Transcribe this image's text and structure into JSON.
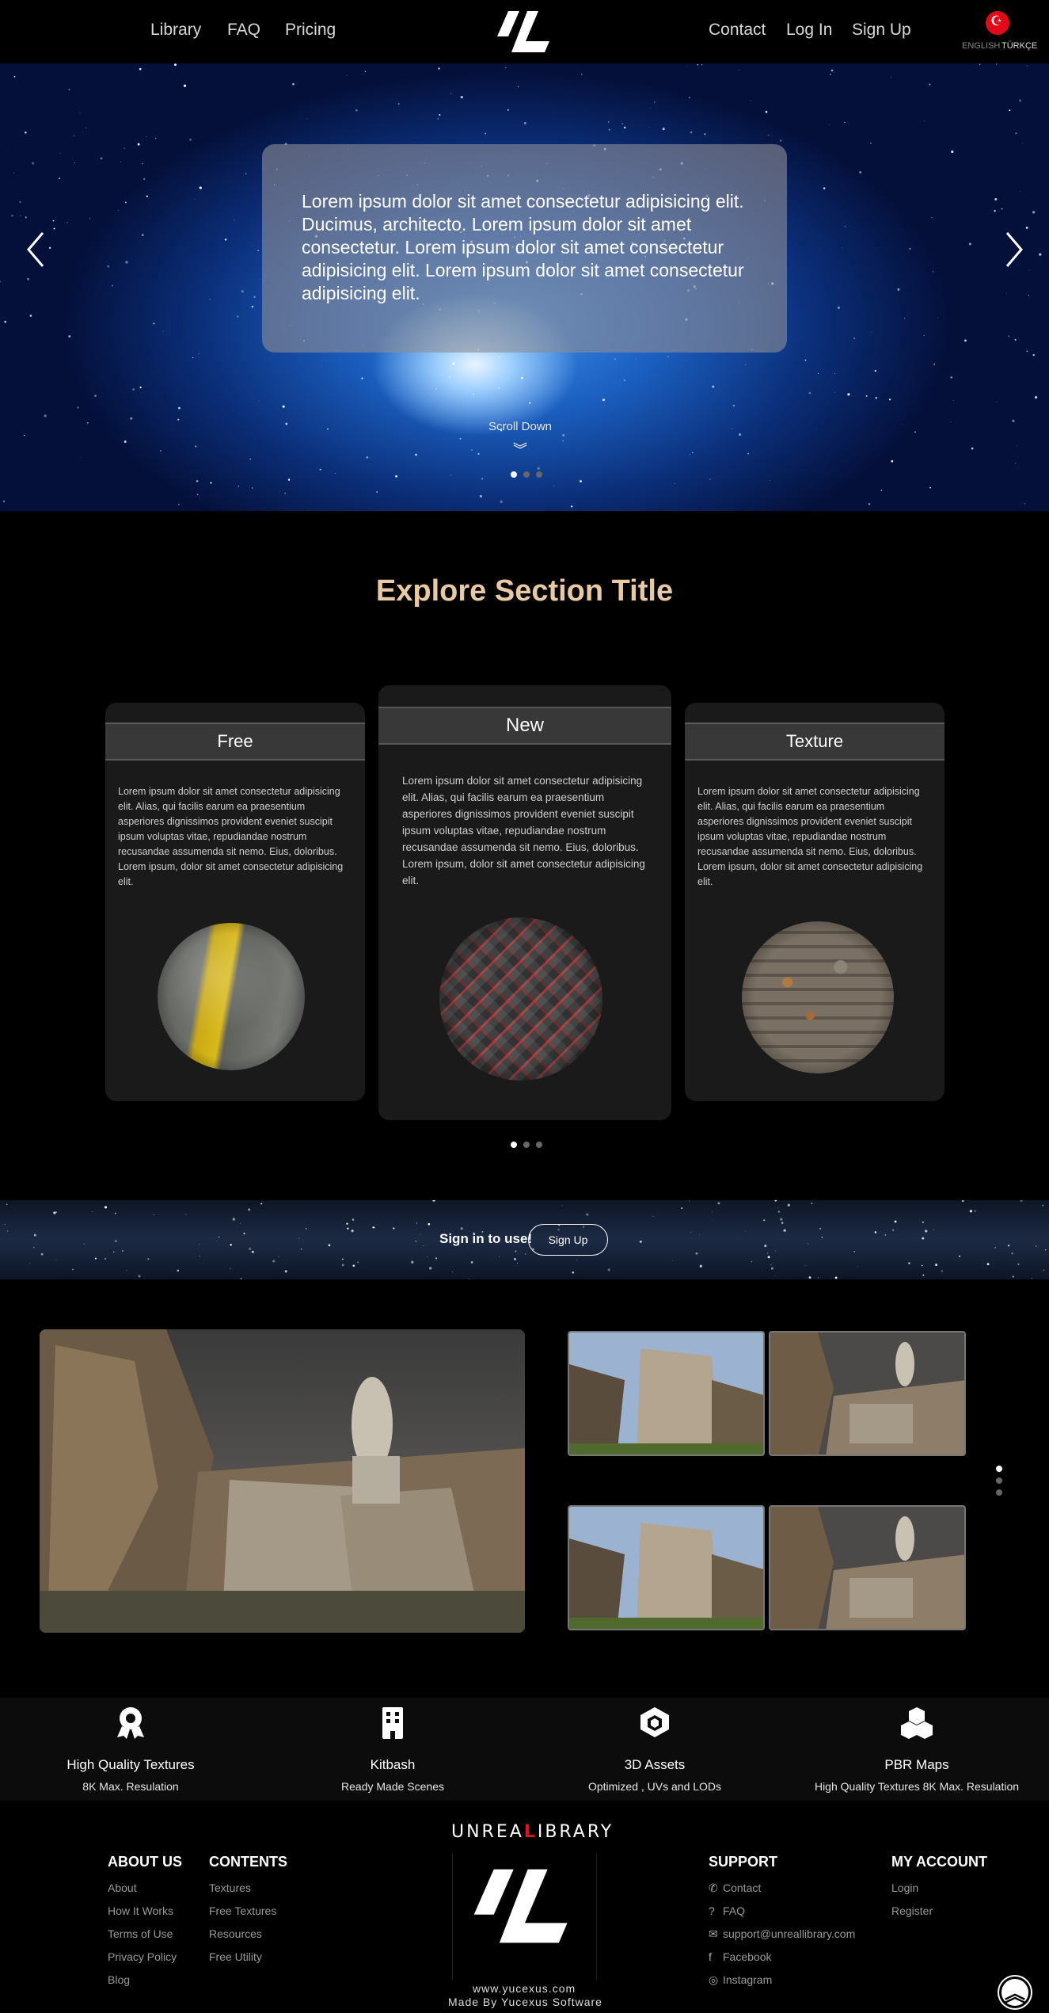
{
  "nav": {
    "left": [
      "Library",
      "FAQ",
      "Pricing"
    ],
    "right": [
      "Contact",
      "Log In",
      "Sign Up"
    ],
    "lang_en": "ENGLISH",
    "lang_tr": "TÜRKÇE"
  },
  "hero": {
    "text": "Lorem ipsum dolor sit amet consectetur adipisicing elit. Ducimus, architecto. Lorem ipsum dolor sit amet consectetur. Lorem ipsum dolor sit amet consectetur adipisicing elit. Lorem ipsum dolor sit amet consectetur adipisicing elit.",
    "scroll_label": "Scroll Down",
    "scroll_icon": "chevron-double-down-icon",
    "active_slide": 1,
    "slide_count": 3
  },
  "explore": {
    "title": "Explore Section Title",
    "card_text": "Lorem ipsum dolor sit amet consectetur adipisicing elit. Alias, qui facilis earum ea praesentium asperiores dignissimos provident eveniet suscipit ipsum voluptas vitae, repudiandae nostrum recusandae assumenda sit nemo. Eius, doloribus. Lorem ipsum, dolor sit amet consectetur adipisicing elit.",
    "cards": [
      {
        "title": "Free"
      },
      {
        "title": "New"
      },
      {
        "title": "Texture"
      }
    ],
    "active_slide": 1,
    "slide_count": 3
  },
  "signin": {
    "text": "Sign in to use!",
    "button": "Sign Up"
  },
  "gallery": {
    "active_slide": 1,
    "slide_count": 3
  },
  "features": [
    {
      "icon": "award-icon",
      "title": "High Quality Textures",
      "sub": "8K Max. Resulation"
    },
    {
      "icon": "building-icon",
      "title": "Kitbash",
      "sub": "Ready Made Scenes"
    },
    {
      "icon": "unity-icon",
      "title": "3D Assets",
      "sub": "Optimized , UVs and LODs"
    },
    {
      "icon": "cubes-icon",
      "title": "PBR Maps",
      "sub": "High Quality Textures 8K Max. Resulation"
    }
  ],
  "footer": {
    "about": {
      "title": "ABOUT US",
      "links": [
        "About",
        "How It Works",
        "Terms of Use",
        "Privacy Policy",
        "Blog"
      ]
    },
    "contents": {
      "title": "CONTENTS",
      "links": [
        "Textures",
        "Free Textures",
        "Resources",
        "Free Utility"
      ]
    },
    "support": {
      "title": "SUPPORT",
      "links": [
        {
          "icon": "phone-icon",
          "label": "Contact"
        },
        {
          "icon": "question-circle-icon",
          "label": "FAQ"
        },
        {
          "icon": "envelope-icon",
          "label": "support@unreallibrary.com"
        },
        {
          "icon": "facebook-icon",
          "label": "Facebook"
        },
        {
          "icon": "instagram-icon",
          "label": "Instagram"
        }
      ]
    },
    "account": {
      "title": "MY ACCOUNT",
      "links": [
        "Login",
        "Register"
      ]
    },
    "brand_pre": "UNREA",
    "brand_l": "L",
    "brand_post": "IBRARY",
    "url": "www.yucexus.com",
    "made_by": "Made By Yucexus Software"
  },
  "colors": {
    "accent_title": "#e7c9a2",
    "brand_red": "#e0141e",
    "card_bg": "#1a1a1a"
  }
}
